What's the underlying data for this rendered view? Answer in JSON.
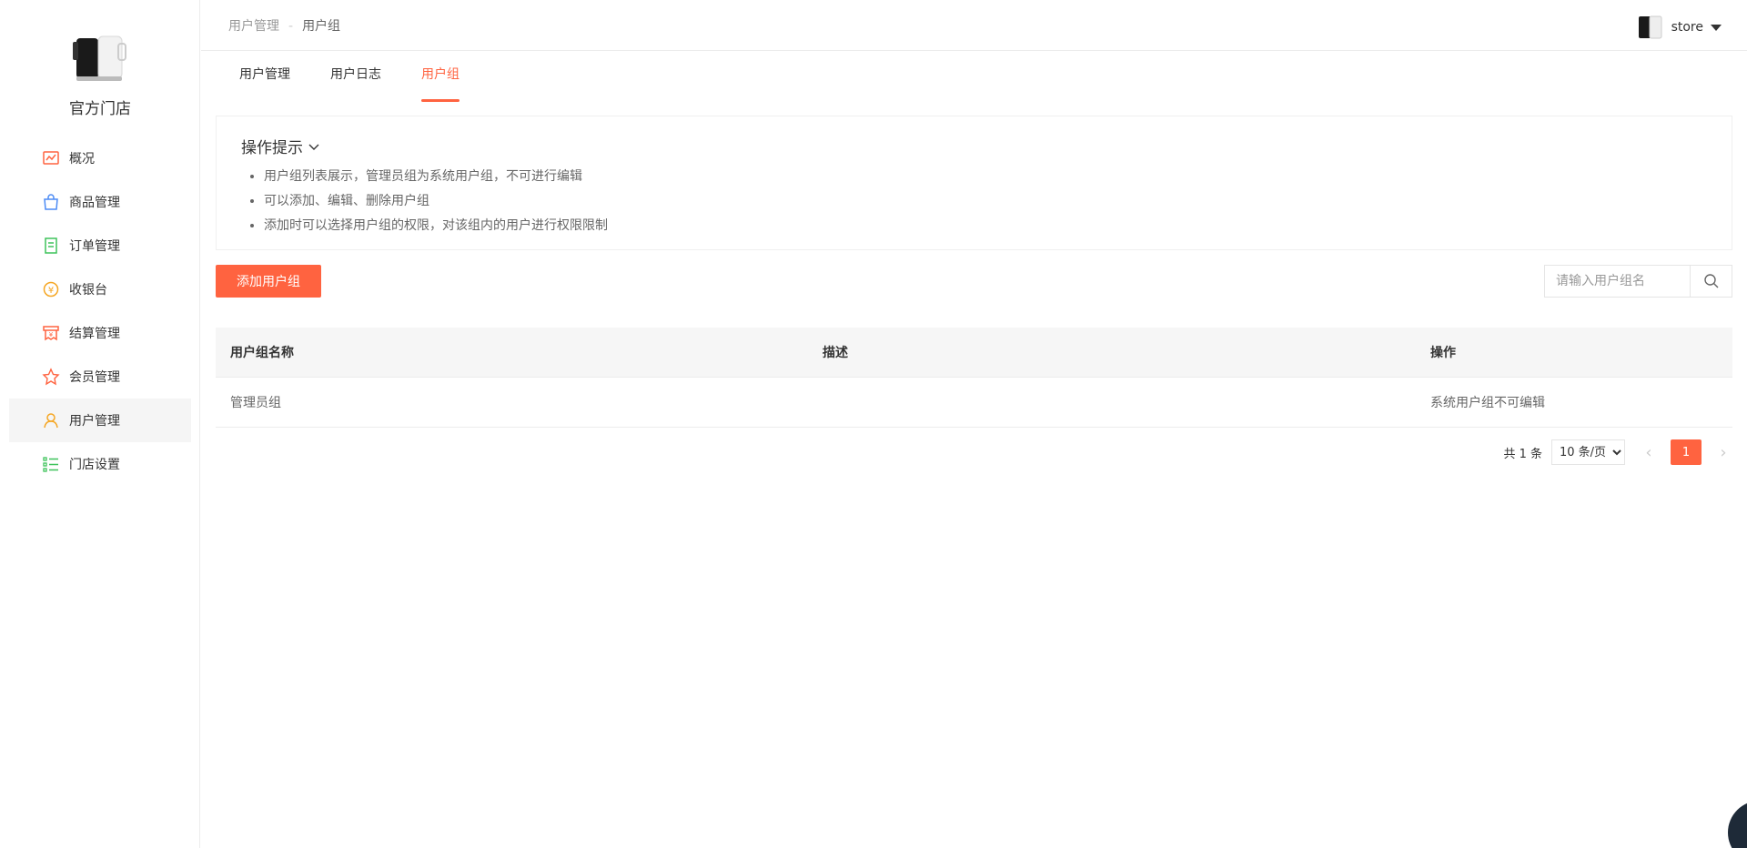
{
  "sidebar": {
    "store_name": "官方门店",
    "items": [
      {
        "label": "概况",
        "icon": "chart-icon",
        "color": "#ff6340"
      },
      {
        "label": "商品管理",
        "icon": "bag-icon",
        "color": "#4d8cf5"
      },
      {
        "label": "订单管理",
        "icon": "order-icon",
        "color": "#3ec35b"
      },
      {
        "label": "收银台",
        "icon": "cashier-icon",
        "color": "#f5a623"
      },
      {
        "label": "结算管理",
        "icon": "settlement-icon",
        "color": "#ff6340"
      },
      {
        "label": "会员管理",
        "icon": "star-icon",
        "color": "#ff6340"
      },
      {
        "label": "用户管理",
        "icon": "user-icon",
        "color": "#f5a623",
        "active": true
      },
      {
        "label": "门店设置",
        "icon": "list-icon",
        "color": "#3ec35b"
      }
    ]
  },
  "header": {
    "breadcrumb": [
      "用户管理",
      "用户组"
    ],
    "breadcrumb_sep": "-",
    "user_name": "store"
  },
  "tabs": [
    {
      "label": "用户管理"
    },
    {
      "label": "用户日志"
    },
    {
      "label": "用户组",
      "active": true
    }
  ],
  "tips": {
    "title": "操作提示",
    "items": [
      "用户组列表展示，管理员组为系统用户组，不可进行编辑",
      "可以添加、编辑、删除用户组",
      "添加时可以选择用户组的权限，对该组内的用户进行权限限制"
    ]
  },
  "toolbar": {
    "add_label": "添加用户组",
    "search_placeholder": "请输入用户组名"
  },
  "table": {
    "headers": [
      "用户组名称",
      "描述",
      "操作"
    ],
    "rows": [
      [
        "管理员组",
        "",
        "系统用户组不可编辑"
      ]
    ]
  },
  "pager": {
    "total": "共 1 条",
    "page_size": "10 条/页",
    "current_page": "1",
    "prev": "‹",
    "next": "›"
  },
  "colors": {
    "accent": "#ff6340"
  }
}
